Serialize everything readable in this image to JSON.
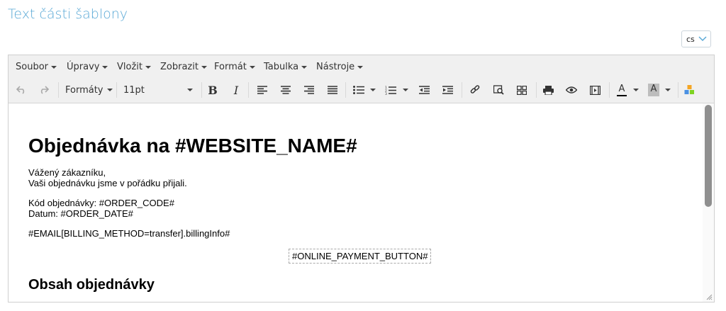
{
  "page": {
    "title": "Text části šablony"
  },
  "language": {
    "selected": "cs"
  },
  "menubar": {
    "items": [
      "Soubor",
      "Úpravy",
      "Vložit",
      "Zobrazit",
      "Formát",
      "Tabulka",
      "Nástroje"
    ]
  },
  "toolbar": {
    "formats_label": "Formáty",
    "font_size": "11pt",
    "bold_label": "B",
    "italic_label": "I",
    "icons": [
      "undo-icon",
      "redo-icon",
      "bold-icon",
      "italic-icon",
      "align-left-icon",
      "align-center-icon",
      "align-right-icon",
      "align-justify-icon",
      "bullet-list-icon",
      "numbered-list-icon",
      "outdent-icon",
      "indent-icon",
      "link-icon",
      "find-icon",
      "grid-icon",
      "print-icon",
      "preview-icon",
      "media-icon",
      "text-color-icon",
      "background-color-icon",
      "blocks-icon"
    ],
    "text_color_label": "A",
    "bg_color_label": "A",
    "colors": {
      "text_underline": "#000000",
      "bg_swatch": "#bdbdbd"
    }
  },
  "content": {
    "heading": "Objednávka na #WEBSITE_NAME#",
    "greeting_line1": "Vážený zákazníku,",
    "greeting_line2": "Vaši objednávku jsme v pořádku přijali.",
    "order_code": "Kód objednávky: #ORDER_CODE#",
    "order_date": "Datum: #ORDER_DATE#",
    "billing_info": "#EMAIL[BILLING_METHOD=transfer].billingInfo#",
    "payment_button": "#ONLINE_PAYMENT_BUTTON#",
    "subheading": "Obsah objednávky"
  },
  "colors": {
    "title": "#5aa9d6",
    "toolbar_bg": "#f0f0f0"
  }
}
